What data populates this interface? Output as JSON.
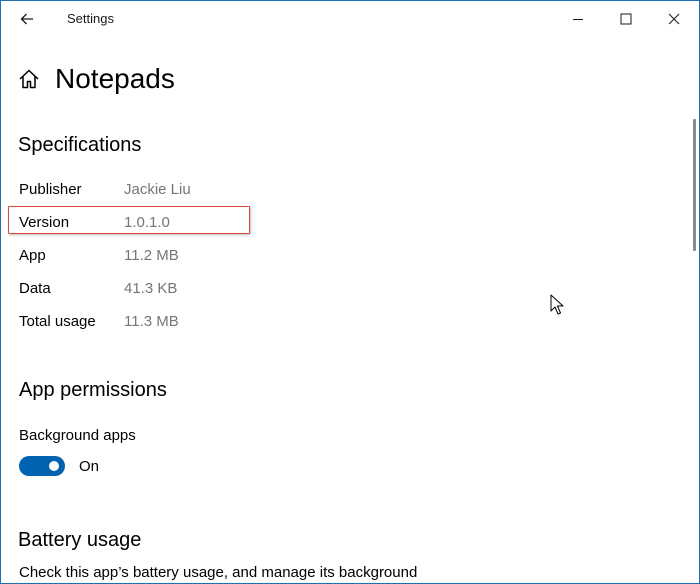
{
  "window": {
    "title": "Settings"
  },
  "header": {
    "page_title": "Notepads"
  },
  "specifications": {
    "section_title": "Specifications",
    "rows": [
      {
        "label": "Publisher",
        "value": "Jackie Liu"
      },
      {
        "label": "Version",
        "value": "1.0.1.0"
      },
      {
        "label": "App",
        "value": "11.2 MB"
      },
      {
        "label": "Data",
        "value": "41.3 KB"
      },
      {
        "label": "Total usage",
        "value": "11.3 MB"
      }
    ]
  },
  "permissions": {
    "section_title": "App permissions",
    "background_apps_label": "Background apps",
    "toggle_state": "On",
    "toggle_on": true
  },
  "battery": {
    "section_title": "Battery usage",
    "description": "Check this app’s battery usage, and manage its background"
  },
  "colors": {
    "accent": "#0063b1",
    "highlight_border": "#e0443e",
    "window_border": "#1f6fb4",
    "secondary_text": "#767676"
  },
  "icons": {
    "back": "back-arrow-icon",
    "home": "home-icon",
    "minimize": "minimize-icon",
    "maximize": "maximize-icon",
    "close": "close-icon",
    "cursor": "mouse-cursor-icon"
  }
}
